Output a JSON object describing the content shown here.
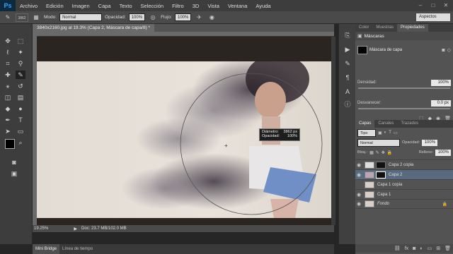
{
  "app": {
    "logo": "Ps"
  },
  "menu": [
    "Archivo",
    "Edición",
    "Imagen",
    "Capa",
    "Texto",
    "Selección",
    "Filtro",
    "3D",
    "Vista",
    "Ventana",
    "Ayuda"
  ],
  "options": {
    "brush_size": "3862",
    "mode_label": "Modo:",
    "mode_value": "Normal",
    "opacity_label": "Opacidad:",
    "opacity_value": "100%",
    "flow_label": "Flujo:",
    "flow_value": "100%",
    "workspace": "Aspectos esen..."
  },
  "document": {
    "tab_title": "3840x2160.jpg al 19.3% (Capa 2, Máscara de capa/8) *",
    "zoom": "19.25%",
    "doc_size": "Doc: 23.7 MB/102.0 MB"
  },
  "brush_tooltip": {
    "diameter_label": "Diámetro:",
    "diameter_value": "3862 px",
    "opacity_label": "Opacidad:",
    "opacity_value": "100%"
  },
  "bottom_tabs": [
    "Mini Bridge",
    "Línea de tiempo"
  ],
  "properties_panel": {
    "tabs": [
      "Color",
      "Muestras",
      "Propiedades"
    ],
    "active_tab": "Propiedades",
    "section": "Máscaras",
    "mask_label": "Máscara de capa",
    "density_label": "Densidad:",
    "density_value": "100%",
    "feather_label": "Desvanecer:",
    "feather_value": "0.0 px"
  },
  "layers_panel": {
    "tabs": [
      "Capas",
      "Canales",
      "Trazados"
    ],
    "active_tab": "Capas",
    "filter_kind": "Tipo",
    "blend_mode": "Normal",
    "opacity_label": "Opacidad:",
    "opacity_value": "100%",
    "lock_label": "Bloq.:",
    "fill_label": "Relleno:",
    "fill_value": "100%",
    "layers": [
      "Capa 2 copia",
      "Capa 2",
      "Capa 1 copia",
      "Capa 1",
      "Fondo"
    ],
    "selected_layer": "Capa 2"
  },
  "colors": {
    "accent": "#31a8ff",
    "selection": "#586a80"
  }
}
